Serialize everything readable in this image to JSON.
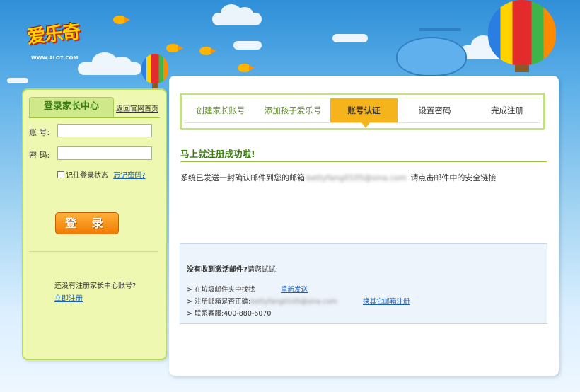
{
  "brand": {
    "logo_text": "爱乐奇",
    "logo_sub": "WWW.ALO7.COM"
  },
  "login": {
    "title": "登录家长中心",
    "home_link": "返回官网首页",
    "account_label": "账  号:",
    "password_label": "密  码:",
    "account_value": "",
    "password_value": "",
    "remember_label": "记住登录状态",
    "forgot_link": "忘记密码?",
    "login_button": "登 录",
    "no_account_text": "还没有注册家长中心账号?",
    "register_link": "立即注册"
  },
  "steps": [
    {
      "label": "创建家长账号",
      "state": "done"
    },
    {
      "label": "添加孩子爱乐号",
      "state": "done"
    },
    {
      "label": "账号认证",
      "state": "active"
    },
    {
      "label": "设置密码",
      "state": "todo"
    },
    {
      "label": "完成注册",
      "state": "todo"
    }
  ],
  "main": {
    "success_title": "马上就注册成功啦!",
    "message_prefix": "系统已发送一封确认邮件到您的邮箱",
    "email_masked": "bettyfang0105@sina.com",
    "message_suffix": "请点击邮件中的安全链接"
  },
  "hint": {
    "title_bold": "没有收到激活邮件?",
    "title_rest": "请您试试:",
    "line1": "> 在垃圾邮件夹中找找",
    "resend_link": "重新发送",
    "line2_prefix": "> 注册邮箱是否正确:",
    "line2_email": "bettyfang0105@sina.com",
    "change_email_link": "换其它邮箱注册",
    "line3": "> 联系客服:400-880-6070"
  },
  "colors": {
    "accent_green": "#3a7a12",
    "active_step": "#f6b41c",
    "login_button": "#f07c00",
    "link": "#1a5fb4"
  }
}
